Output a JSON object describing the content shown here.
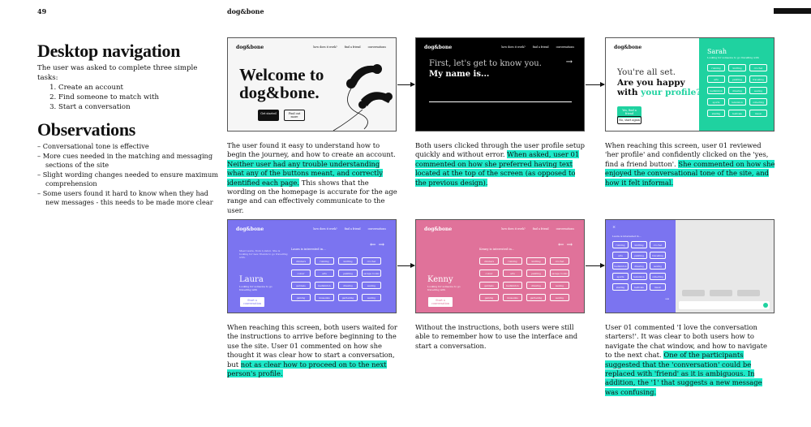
{
  "page": {
    "number": "49",
    "brand": "dog&bone"
  },
  "nav_section": {
    "title": "Desktop navigation",
    "intro": "The user was asked to complete three simple tasks:",
    "tasks": [
      "Create an account",
      "Find someone to match with",
      "Start a conversation"
    ]
  },
  "observations": {
    "title": "Observations",
    "items": [
      "– Conversational tone is effective",
      "– More cues needed in the matching and messaging sections of the site",
      "– Slight wording changes needed to ensure maximum comprehension",
      "– Some users found it hard to know when they had new messages - this needs to be made more clear"
    ]
  },
  "mini_nav": {
    "logo": "dog&bone",
    "links": [
      "how does it work?",
      "find a friend",
      "conversations"
    ]
  },
  "screens": {
    "s1": {
      "title_line1": "Welcome to",
      "title_line2": "dog&bone.",
      "btn_primary": "Get started",
      "btn_secondary": "Find out more"
    },
    "s2": {
      "prompt": "First, let's get to know you.",
      "question": "My name is...",
      "arrow": "→"
    },
    "s3": {
      "line1": "You're all set.",
      "line2": "Are you happy",
      "line3_pre": "with",
      "line3_accent": "your profile?",
      "btn_yes": "Yes, find a friend",
      "btn_no": "No, start again",
      "name": "Sarah",
      "sub": "Looking for someone to go travelling with",
      "tags": [
        "running",
        "knitting",
        "crochet",
        "arts",
        "painting",
        "travelling",
        "badminton",
        "drawing",
        "sewing",
        "sports",
        "television",
        "collecting",
        "skating",
        "festivals",
        "music"
      ]
    },
    "s4": {
      "heading": "Laura is interested in...",
      "name": "Laura",
      "sub": "Looking for someone to go travelling with",
      "btn": "Start a conversation",
      "blurb": "Meet Laura, from London. She is looking for new friends to go travelling with.",
      "tags": [
        "climbers",
        "running",
        "knitting",
        "crochet",
        "colour",
        "arts",
        "painting",
        "escape rooms",
        "gardens",
        "badminton",
        "drawing",
        "sewing",
        "gaming",
        "museums",
        "gardening",
        "sewing"
      ]
    },
    "s5": {
      "heading": "Kenny is interested in...",
      "name": "Kenny",
      "sub": "Looking for someone to go travelling with",
      "btn": "Start a conversation",
      "tags": [
        "climbers",
        "running",
        "knitting",
        "crochet",
        "colour",
        "arts",
        "painting",
        "escape rooms",
        "gardens",
        "badminton",
        "drawing",
        "sewing",
        "gaming",
        "museums",
        "gardening",
        "sewing"
      ]
    },
    "s6": {
      "close": "×",
      "heading": "Laura is interested in...",
      "tags": [
        "running",
        "knitting",
        "crochet",
        "arts",
        "painting",
        "travelling",
        "badminton",
        "drawing",
        "sewing",
        "sports",
        "television",
        "collecting",
        "skating",
        "festivals",
        "music"
      ]
    }
  },
  "captions": {
    "c1_a": "The user found it easy to understand how to begin the journey, and how to create an account.",
    "c1_hl": "Neither user had any trouble understanding what any of the buttons meant, and correctly identified each page.",
    "c1_b": " This shows that the wording on the homepage is accurate for the age range and can effectively communicate to the user.",
    "c2_a": "Both users clicked through the user profile setup quickly and without error. ",
    "c2_hl": "When asked, user 01 commented on how she preferred having text located at the top of the screen (as opposed to the previous design).",
    "c3_a": "When reaching this screen, user 01 reviewed 'her profile' and confidently clicked on the 'yes, find a friend button'. ",
    "c3_hl": "She commented on how she enjoyed the conversational tone of the site, and how it felt informal.",
    "c4_a": "When reaching this screen, both users waited for the instructions to arrive before beginning to the use the site. User 01 commented on how she thought it was clear how to start a conversation, but ",
    "c4_hl": "not as clear how to proceed on to the next person's profile.",
    "c5_a": "Without the instructions, both users were still able to remember how to use the interface and start a conversation.",
    "c6_a": "User 01 commented 'I love the conversation starters!'. It was clear to both users how to navigate the chat window, and how to navigate to the next chat. ",
    "c6_hl": "One of the participants suggested that the 'conversation' could be replaced with 'friend' as it is ambiguous. In addition, the '1' that suggests a new message was confusing."
  },
  "colors": {
    "highlight": "#1de9c9",
    "green": "#1fd2a0",
    "purple": "#7b74f0",
    "pink": "#e0729a",
    "black": "#000000"
  }
}
